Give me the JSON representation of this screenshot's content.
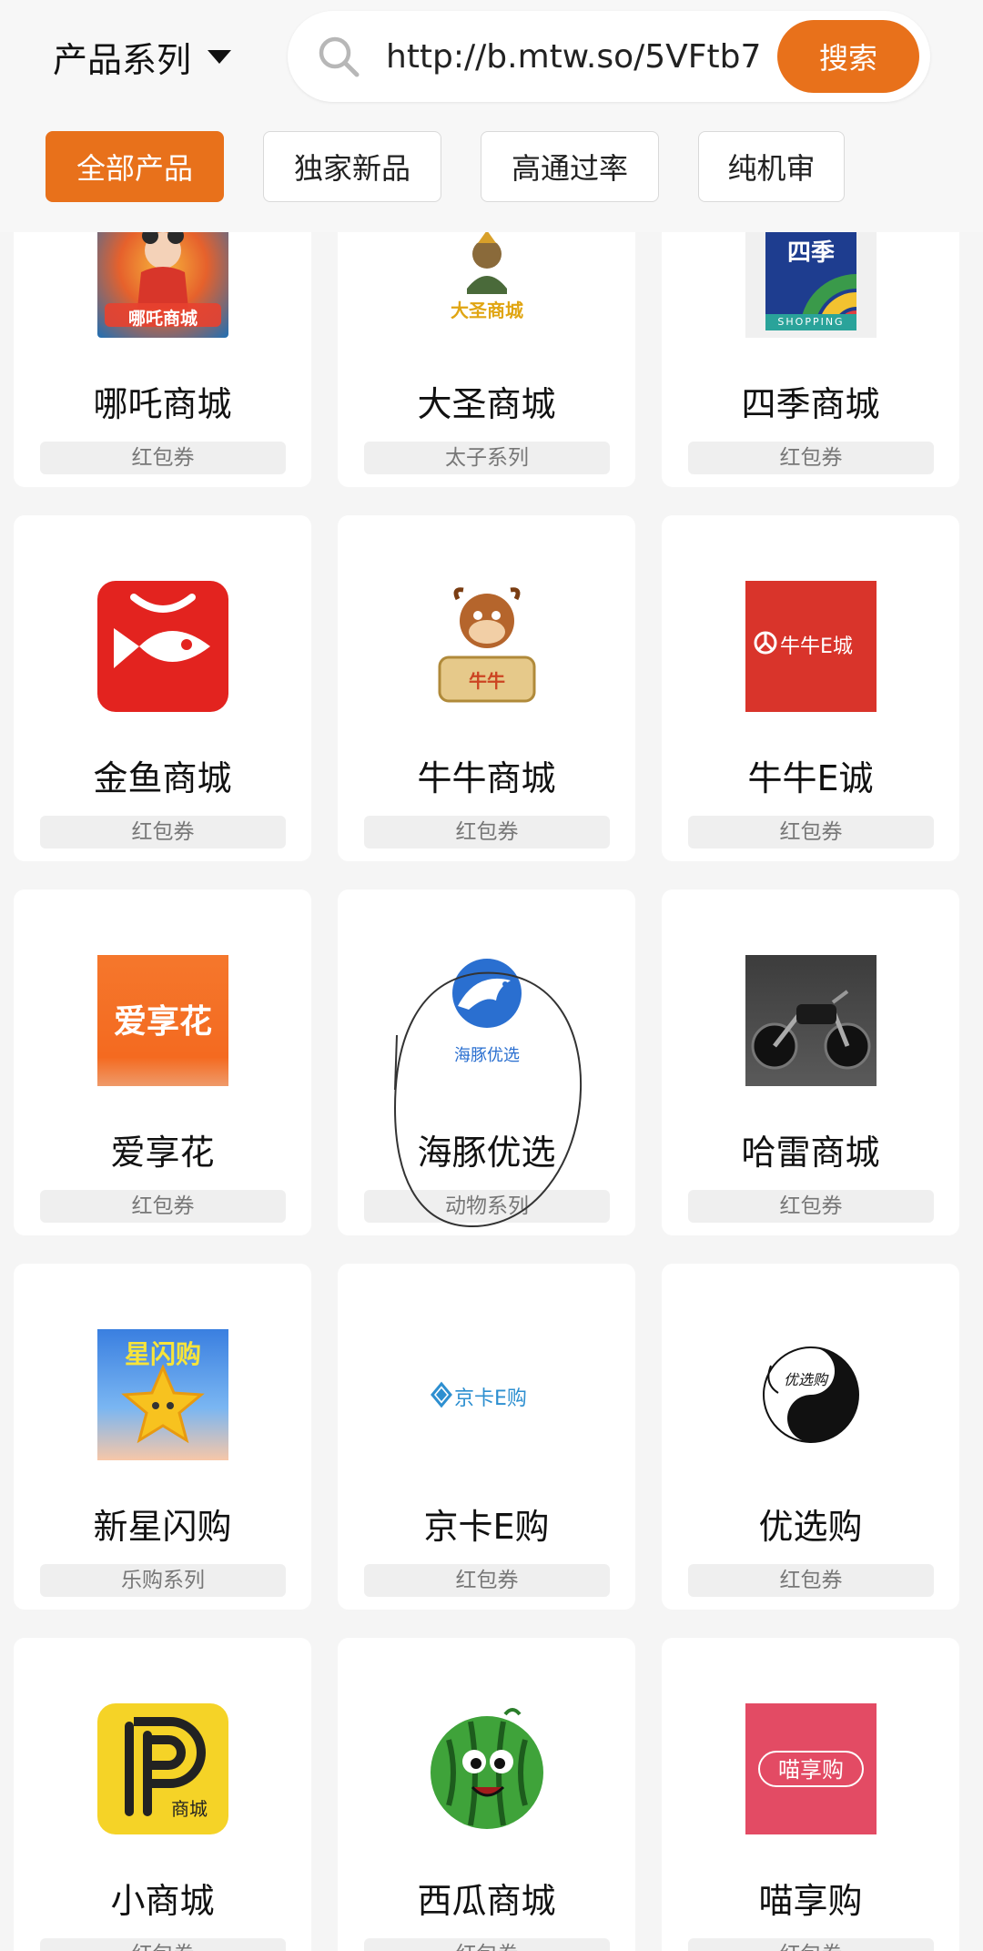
{
  "header": {
    "series_label": "产品系列",
    "search": {
      "value": "http://b.mtw.so/5VFtb7",
      "button_label": "搜索"
    }
  },
  "tabs": [
    {
      "label": "全部产品",
      "active": true
    },
    {
      "label": "独家新品",
      "active": false
    },
    {
      "label": "高通过率",
      "active": false
    },
    {
      "label": "纯机审",
      "active": false
    }
  ],
  "products": [
    {
      "name": "哪吒商城",
      "tag": "红包券",
      "logo_text": "哪吒商城",
      "icon": "nezha-logo-icon"
    },
    {
      "name": "大圣商城",
      "tag": "太子系列",
      "logo_text": "大圣商城",
      "icon": "monkey-king-logo-icon"
    },
    {
      "name": "四季商城",
      "tag": "红包券",
      "logo_text": "四季",
      "logo_sub": "SHOPPING",
      "icon": "shopping-bag-logo-icon"
    },
    {
      "name": "金鱼商城",
      "tag": "红包券",
      "icon": "goldfish-logo-icon"
    },
    {
      "name": "牛牛商城",
      "tag": "红包券",
      "logo_text": "牛牛",
      "icon": "cow-mascot-logo-icon"
    },
    {
      "name": "牛牛E诚",
      "tag": "红包券",
      "logo_text": "牛牛E城",
      "icon": "niuniu-e-logo-icon"
    },
    {
      "name": "爱享花",
      "tag": "红包券",
      "logo_text": "爱享花",
      "icon": "aixianghua-logo-icon"
    },
    {
      "name": "海豚优选",
      "tag": "动物系列",
      "logo_text": "海豚优选",
      "icon": "dolphin-logo-icon"
    },
    {
      "name": "哈雷商城",
      "tag": "红包券",
      "icon": "motorcycle-logo-icon"
    },
    {
      "name": "新星闪购",
      "tag": "乐购系列",
      "logo_text": "星闪购",
      "icon": "star-logo-icon"
    },
    {
      "name": "京卡E购",
      "tag": "红包券",
      "logo_text": "京卡E购",
      "icon": "diamond-logo-icon"
    },
    {
      "name": "优选购",
      "tag": "红包券",
      "logo_text": "优选购",
      "icon": "yin-yang-logo-icon"
    },
    {
      "name": "小商城",
      "tag": "红包券",
      "logo_text": "商城",
      "icon": "p-letter-logo-icon"
    },
    {
      "name": "西瓜商城",
      "tag": "红包券",
      "icon": "watermelon-logo-icon"
    },
    {
      "name": "喵享购",
      "tag": "红包券",
      "logo_text": "喵享购",
      "icon": "miaoxianggou-logo-icon"
    }
  ],
  "colors": {
    "accent": "#e8711b",
    "page_background": "#f5f5f5",
    "card_background": "#ffffff",
    "tag_background": "#efefef"
  }
}
